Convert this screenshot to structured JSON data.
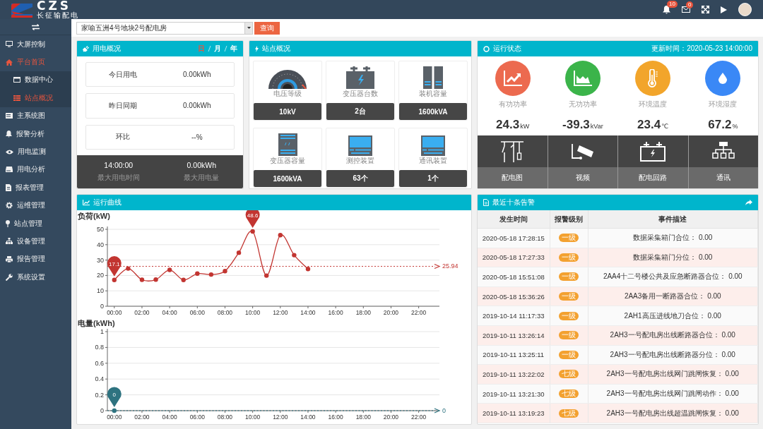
{
  "header": {
    "logo_text": "CZS",
    "logo_subtitle": "长征输配电",
    "notifications": "10",
    "messages": "0"
  },
  "sidebar": {
    "items": [
      {
        "label": "大屏控制",
        "selected": false
      },
      {
        "label": "平台首页",
        "selected": true,
        "children": [
          {
            "label": "数据中心",
            "selected": false
          },
          {
            "label": "站点概况",
            "selected": true
          }
        ]
      },
      {
        "label": "主系统图",
        "selected": false
      },
      {
        "label": "报警分析",
        "selected": false
      },
      {
        "label": "用电监测",
        "selected": false
      },
      {
        "label": "用电分析",
        "selected": false
      },
      {
        "label": "报表管理",
        "selected": false
      },
      {
        "label": "运维管理",
        "selected": false
      },
      {
        "label": "站点管理",
        "selected": false
      },
      {
        "label": "设备管理",
        "selected": false
      },
      {
        "label": "报告管理",
        "selected": false
      },
      {
        "label": "系统设置",
        "selected": false
      }
    ]
  },
  "search": {
    "value": "家喻五洲4号地块2号配电房",
    "button": "查询"
  },
  "usage": {
    "title": "用电概况",
    "periods": [
      {
        "label": "日",
        "selected": true
      },
      {
        "label": "月",
        "selected": false
      },
      {
        "label": "年",
        "selected": false
      }
    ],
    "rows": [
      {
        "label": "今日用电",
        "value": "0.00kWh"
      },
      {
        "label": "昨日同期",
        "value": "0.00kWh"
      },
      {
        "label": "环比",
        "value": "--%"
      }
    ],
    "peak": [
      {
        "value": "14:00:00",
        "label": "最大用电时间"
      },
      {
        "value": "0.00kWh",
        "label": "最大用电量"
      }
    ]
  },
  "site": {
    "title": "站点概况",
    "tiles": [
      {
        "label": "电压等级",
        "value": "10kV"
      },
      {
        "label": "变压器台数",
        "value": "2台"
      },
      {
        "label": "装机容量",
        "value": "1600kVA"
      },
      {
        "label": "变压器容量",
        "value": "1600kVA"
      },
      {
        "label": "测控装置",
        "value": "63个"
      },
      {
        "label": "通讯装置",
        "value": "1个"
      }
    ]
  },
  "status": {
    "title": "运行状态",
    "updated": "更新时间：2020-05-23 14:00:00",
    "metrics": [
      {
        "label": "有功功率",
        "value": "24.3",
        "unit": "kW",
        "color": "#ec6a4f"
      },
      {
        "label": "无功功率",
        "value": "-39.3",
        "unit": "kVar",
        "color": "#3bb44a"
      },
      {
        "label": "环境温度",
        "value": "23.4",
        "unit": "℃",
        "color": "#f2a52b"
      },
      {
        "label": "环境湿度",
        "value": "67.2",
        "unit": "%",
        "color": "#3a88f6"
      }
    ],
    "links": [
      "配电图",
      "视频",
      "配电回路",
      "通讯"
    ]
  },
  "curves": {
    "title": "运行曲线",
    "load": {
      "chart_data": {
        "type": "line",
        "title": "负荷(kW)",
        "x": [
          0,
          1,
          2,
          3,
          4,
          5,
          6,
          7,
          8,
          9,
          10,
          11,
          12,
          13,
          14
        ],
        "series": [
          {
            "color": "#c23531",
            "marker": "circle",
            "values": [
              17.1,
              24.5,
              17.2,
              17.3,
              23.6,
              17.1,
              21.2,
              20.6,
              22.8,
              34.8,
              48.6,
              19.9,
              46.2,
              33.2,
              24.2
            ]
          }
        ],
        "xlim": [
          -0.5,
          23.5
        ],
        "ylim": [
          0,
          50
        ],
        "yticks": [
          0,
          10,
          20,
          30,
          40,
          50
        ],
        "grid": true,
        "xticks": [
          {
            "value": 0,
            "label": "00:00"
          },
          {
            "value": 2,
            "label": "02:00"
          },
          {
            "value": 4,
            "label": "04:00"
          },
          {
            "value": 6,
            "label": "06:00"
          },
          {
            "value": 8,
            "label": "08:00"
          },
          {
            "value": 10,
            "label": "10:00"
          },
          {
            "value": 12,
            "label": "12:00"
          },
          {
            "value": 14,
            "label": "14:00"
          },
          {
            "value": 16,
            "label": "16:00"
          },
          {
            "value": 18,
            "label": "18:00"
          },
          {
            "value": 20,
            "label": "20:00"
          },
          {
            "value": 22,
            "label": "22:00"
          }
        ],
        "annotations": [
          {
            "x": 0,
            "y": 17.1,
            "text": "17.1"
          },
          {
            "x": 10,
            "y": 48.6,
            "text": "48.6"
          }
        ],
        "ref_lines": [
          {
            "axis": "y",
            "value": 25.94,
            "color": "#c23531",
            "label": "25.94"
          }
        ]
      }
    },
    "energy": {
      "chart_data": {
        "type": "line",
        "title": "电量(kWh)",
        "x": [
          0
        ],
        "series": [
          {
            "color": "#2e7380",
            "marker": "circle",
            "values": [
              0
            ]
          }
        ],
        "xlim": [
          -0.5,
          23.5
        ],
        "ylim": [
          0,
          1
        ],
        "yticks": [
          0,
          0.2,
          0.4,
          0.6,
          0.8,
          1
        ],
        "grid": true,
        "xticks": [
          {
            "value": 0,
            "label": "00:00"
          },
          {
            "value": 2,
            "label": "02:00"
          },
          {
            "value": 4,
            "label": "04:00"
          },
          {
            "value": 6,
            "label": "06:00"
          },
          {
            "value": 8,
            "label": "08:00"
          },
          {
            "value": 10,
            "label": "10:00"
          },
          {
            "value": 12,
            "label": "12:00"
          },
          {
            "value": 14,
            "label": "14:00"
          },
          {
            "value": 16,
            "label": "16:00"
          },
          {
            "value": 18,
            "label": "18:00"
          },
          {
            "value": 20,
            "label": "20:00"
          },
          {
            "value": 22,
            "label": "22:00"
          }
        ],
        "annotations": [
          {
            "x": 0,
            "y": 0,
            "text": "0"
          }
        ],
        "ref_lines": [
          {
            "axis": "y",
            "value": 0,
            "color": "#2e7380",
            "label": "0"
          }
        ]
      }
    }
  },
  "alarms": {
    "title": "最近十条告警",
    "columns": [
      "发生时间",
      "报警级别",
      "事件描述"
    ],
    "rows": [
      {
        "time": "2020-05-18 17:28:15",
        "level": "一级",
        "event": "数据采集箱门合位： 0.00"
      },
      {
        "time": "2020-05-18 17:27:33",
        "level": "一级",
        "event": "数据采集箱门分位： 0.00"
      },
      {
        "time": "2020-05-18 15:51:08",
        "level": "一级",
        "event": "2AA4十二号楼公共及应急断路器合位： 0.00"
      },
      {
        "time": "2020-05-18 15:36:26",
        "level": "一级",
        "event": "2AA3备用一断路器合位： 0.00"
      },
      {
        "time": "2019-10-14 11:17:33",
        "level": "一级",
        "event": "2AH1高压进线地刀合位： 0.00"
      },
      {
        "time": "2019-10-11 13:26:14",
        "level": "一级",
        "event": "2AH3一号配电房出线断路器合位： 0.00"
      },
      {
        "time": "2019-10-11 13:25:11",
        "level": "一级",
        "event": "2AH3一号配电房出线断路器分位： 0.00"
      },
      {
        "time": "2019-10-11 13:22:02",
        "level": "七级",
        "event": "2AH3一号配电房出线网门跳闸恢复： 0.00"
      },
      {
        "time": "2019-10-11 13:21:30",
        "level": "七级",
        "event": "2AH3一号配电房出线网门跳闸动作： 0.00"
      },
      {
        "time": "2019-10-11 13:19:23",
        "level": "七级",
        "event": "2AH3一号配电房出线超温跳闸恢复： 0.00"
      }
    ]
  }
}
